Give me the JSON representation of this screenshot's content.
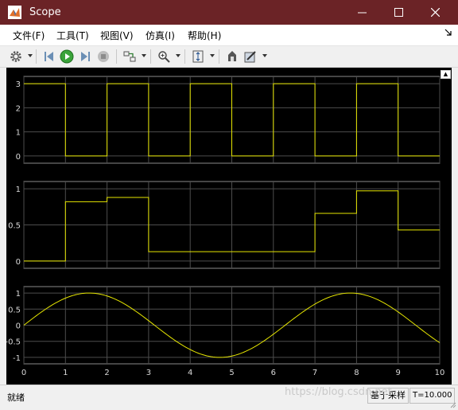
{
  "window": {
    "title": "Scope"
  },
  "menu": [
    "文件(F)",
    "工具(T)",
    "视图(V)",
    "仿真(I)",
    "帮助(H)"
  ],
  "toolbar": {
    "icons": [
      "gear-icon",
      "step-back-icon",
      "run-icon",
      "step-forward-icon",
      "stop-icon",
      "signal-select-icon",
      "zoom-icon",
      "scale-axes-icon",
      "highlight-block-icon",
      "style-icon"
    ]
  },
  "statusbar": {
    "status": "就绪",
    "mode": "基于采样",
    "time": "T=10.000"
  },
  "watermark": "https://blog.csdn.net",
  "colors": {
    "trace": "#e6e600",
    "plot_bg": "#000000",
    "grid": "#4d4d4d",
    "axis_text": "#d9d9d9",
    "titlebar": "#6b2326"
  },
  "chart_data": [
    {
      "type": "line",
      "step": true,
      "x": [
        0,
        1,
        2,
        3,
        4,
        5,
        6,
        7,
        8,
        9,
        10
      ],
      "values": [
        3,
        0,
        3,
        0,
        3,
        0,
        3,
        0,
        3,
        0,
        0
      ],
      "xlim": [
        0,
        10
      ],
      "ylim": [
        -0.3,
        3.3
      ],
      "yticks": [
        "0",
        "1",
        "2",
        "3"
      ]
    },
    {
      "type": "line",
      "step": true,
      "x": [
        0,
        1,
        2,
        3,
        4,
        5,
        6,
        7,
        8,
        9,
        10
      ],
      "values": [
        0,
        0.82,
        0.88,
        0.13,
        0.13,
        0.13,
        0.13,
        0.66,
        0.97,
        0.43,
        0.43
      ],
      "xlim": [
        0,
        10
      ],
      "ylim": [
        -0.1,
        1.1
      ],
      "yticks": [
        "0",
        "0.5",
        "1"
      ]
    },
    {
      "type": "line",
      "function": "sin",
      "x": [
        0,
        0.5,
        1,
        1.5,
        2,
        2.5,
        3,
        3.5,
        4,
        4.5,
        5,
        5.5,
        6,
        6.5,
        7,
        7.5,
        8,
        8.5,
        9,
        9.5,
        10
      ],
      "values": [
        0,
        0.479,
        0.841,
        0.997,
        0.909,
        0.598,
        0.141,
        -0.351,
        -0.757,
        -0.978,
        -0.959,
        -0.706,
        -0.279,
        0.215,
        0.657,
        0.938,
        0.989,
        0.798,
        0.412,
        -0.075,
        -0.544
      ],
      "xlim": [
        0,
        10
      ],
      "ylim": [
        -1.2,
        1.2
      ],
      "yticks": [
        "-1",
        "-0.5",
        "0",
        "0.5",
        "1"
      ],
      "xticks": [
        "0",
        "1",
        "2",
        "3",
        "4",
        "5",
        "6",
        "7",
        "8",
        "9",
        "10"
      ]
    }
  ]
}
